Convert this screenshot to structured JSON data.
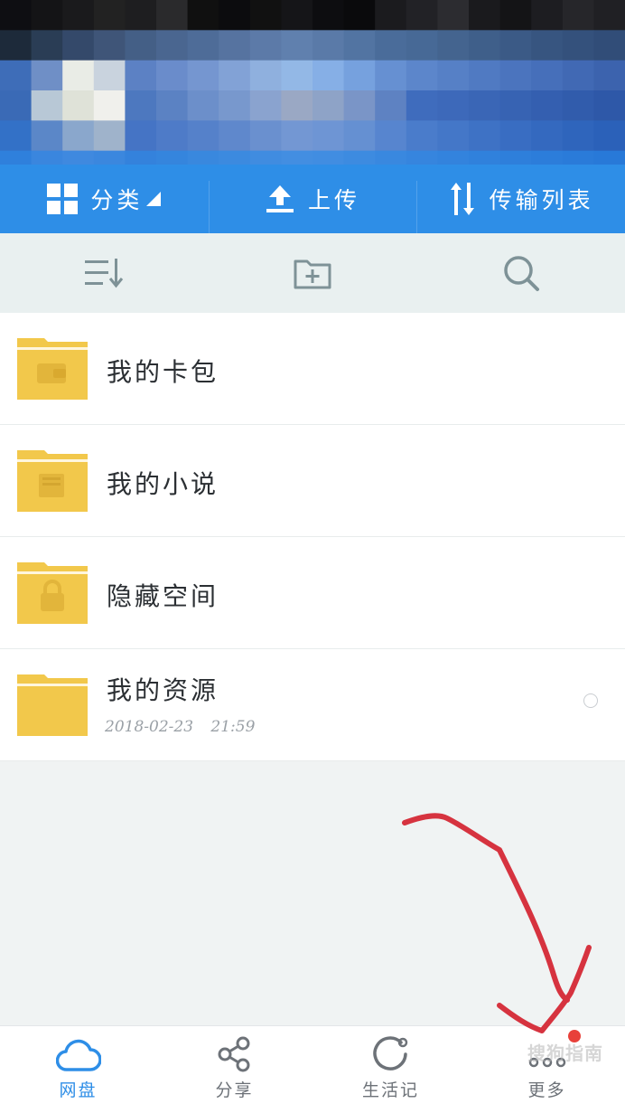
{
  "action_bar": {
    "category_label": "分类",
    "upload_label": "上传",
    "transfer_label": "传输列表"
  },
  "toolbar": {
    "sort_icon": "sort-icon",
    "new_folder_icon": "new-folder-icon",
    "search_icon": "search-icon"
  },
  "files": [
    {
      "name": "我的卡包",
      "icon": "wallet-icon"
    },
    {
      "name": "我的小说",
      "icon": "book-icon"
    },
    {
      "name": "隐藏空间",
      "icon": "lock-icon"
    },
    {
      "name": "我的资源",
      "date": "2018-02-23",
      "time": "21:59"
    }
  ],
  "bottom_nav": {
    "items": [
      {
        "label": "网盘",
        "icon": "cloud-icon",
        "active": true
      },
      {
        "label": "分享",
        "icon": "share-icon",
        "active": false
      },
      {
        "label": "生活记",
        "icon": "ring-icon",
        "active": false
      },
      {
        "label": "更多",
        "icon": "more-icon",
        "active": false,
        "badge": true
      }
    ]
  },
  "watermark": "搜狗指南",
  "colors": {
    "primary": "#2e8ee7",
    "folder": "#f2c84b",
    "badge": "#e8413a",
    "annotation": "#d6333f"
  }
}
